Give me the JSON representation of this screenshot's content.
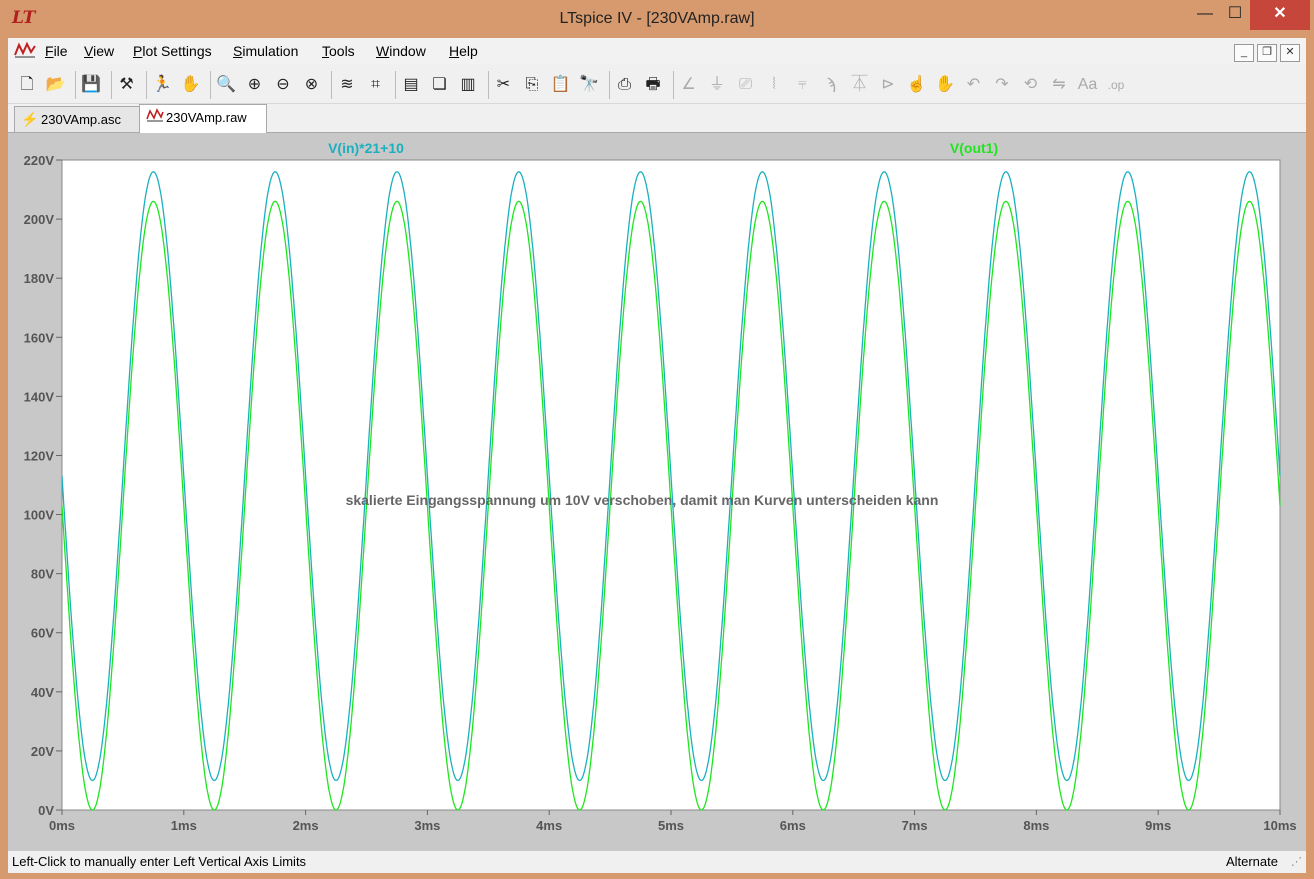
{
  "window": {
    "title": "LTspice IV - [230VAmp.raw]",
    "app_icon": "LT",
    "minimize_glyph": "—",
    "maximize_glyph": "☐",
    "close_glyph": "✕"
  },
  "menu": {
    "items": [
      {
        "u": "F",
        "rest": "ile"
      },
      {
        "u": "V",
        "rest": "iew"
      },
      {
        "u": "P",
        "rest": "lot Settings"
      },
      {
        "u": "S",
        "rest": "imulation"
      },
      {
        "u": "T",
        "rest": "ools"
      },
      {
        "u": "W",
        "rest": "indow"
      },
      {
        "u": "H",
        "rest": "elp"
      }
    ],
    "mdi_min": "_",
    "mdi_restore": "❐",
    "mdi_close": "✕"
  },
  "toolbar": {
    "icons": [
      {
        "name": "new-schematic-icon",
        "glyph": "🗋"
      },
      {
        "name": "open-icon",
        "glyph": "📂"
      },
      {
        "name": "save-icon",
        "glyph": "💾"
      },
      {
        "name": "control-panel-icon",
        "glyph": "⚒"
      },
      {
        "name": "run-icon",
        "glyph": "🏃"
      },
      {
        "name": "halt-icon",
        "glyph": "✋"
      },
      {
        "name": "zoom-area-icon",
        "glyph": "🔍"
      },
      {
        "name": "zoom-in-icon",
        "glyph": "⊕"
      },
      {
        "name": "zoom-out-icon",
        "glyph": "⊖"
      },
      {
        "name": "zoom-fit-icon",
        "glyph": "⊗"
      },
      {
        "name": "autorange-icon",
        "glyph": "≋"
      },
      {
        "name": "fit-icon",
        "glyph": "⌗"
      },
      {
        "name": "tile-horizontal-icon",
        "glyph": "▤"
      },
      {
        "name": "cascade-icon",
        "glyph": "❏"
      },
      {
        "name": "tile-vertical-icon",
        "glyph": "▥"
      },
      {
        "name": "cut-icon",
        "glyph": "✂"
      },
      {
        "name": "copy-icon",
        "glyph": "⎘"
      },
      {
        "name": "paste-icon",
        "glyph": "📋"
      },
      {
        "name": "find-icon",
        "glyph": "🔭"
      },
      {
        "name": "print-preview-icon",
        "glyph": "⎙"
      },
      {
        "name": "print-icon",
        "glyph": "🖶"
      },
      {
        "name": "wire-icon",
        "glyph": "∠"
      },
      {
        "name": "ground-icon",
        "glyph": "⏚"
      },
      {
        "name": "label-icon",
        "glyph": "⎚"
      },
      {
        "name": "resistor-icon",
        "glyph": "⦚"
      },
      {
        "name": "capacitor-icon",
        "glyph": "⫧"
      },
      {
        "name": "inductor-icon",
        "glyph": "ϡ"
      },
      {
        "name": "diode-icon",
        "glyph": "⏄"
      },
      {
        "name": "component-icon",
        "glyph": "⊳"
      },
      {
        "name": "move-icon",
        "glyph": "☝"
      },
      {
        "name": "drag-icon",
        "glyph": "✋"
      },
      {
        "name": "undo-icon",
        "glyph": "↶"
      },
      {
        "name": "redo-icon",
        "glyph": "↷"
      },
      {
        "name": "rotate-icon",
        "glyph": "⟲"
      },
      {
        "name": "mirror-icon",
        "glyph": "⇋"
      },
      {
        "name": "text-icon",
        "glyph": "Aa"
      },
      {
        "name": "spice-directive-icon",
        "glyph": ".op"
      }
    ]
  },
  "tabs": [
    {
      "label": "230VAmp.asc",
      "icon": "schematic-icon",
      "glyph": "⚡"
    },
    {
      "label": "230VAmp.raw",
      "icon": "waveform-icon",
      "glyph": "📈"
    }
  ],
  "plot": {
    "trace1_label": "V(in)*21+10",
    "trace2_label": "V(out1)",
    "annotation": "skalierte Eingangsspannung um 10V verschoben, damit man Kurven unterscheiden kann",
    "colors": {
      "background": "#ffffff",
      "frame": "#c8c8c8",
      "axis_text": "#555555",
      "trace1": "#1ab0bf",
      "trace2": "#1ee61e",
      "annotation": "#666666"
    }
  },
  "chart_data": {
    "type": "line",
    "title": "",
    "xlabel": "",
    "ylabel": "",
    "xlim": [
      0,
      10
    ],
    "ylim": [
      0,
      220
    ],
    "x_unit": "ms",
    "y_unit": "V",
    "x_ticks": [
      "0ms",
      "1ms",
      "2ms",
      "3ms",
      "4ms",
      "5ms",
      "6ms",
      "7ms",
      "8ms",
      "9ms",
      "10ms"
    ],
    "y_ticks": [
      "0V",
      "20V",
      "40V",
      "60V",
      "80V",
      "100V",
      "120V",
      "140V",
      "160V",
      "180V",
      "200V",
      "220V"
    ],
    "grid": false,
    "series": [
      {
        "name": "V(in)*21+10",
        "color": "#1ab0bf",
        "offset": 113,
        "amplitude": 103,
        "frequency_per_ms": 1.0,
        "phase": 0
      },
      {
        "name": "V(out1)",
        "color": "#1ee61e",
        "offset": 103,
        "amplitude": 103,
        "frequency_per_ms": 1.0,
        "phase": 0
      }
    ]
  },
  "status": {
    "left": "Left-Click to manually enter Left Vertical Axis Limits",
    "right": "Alternate",
    "grip": "⋰"
  }
}
